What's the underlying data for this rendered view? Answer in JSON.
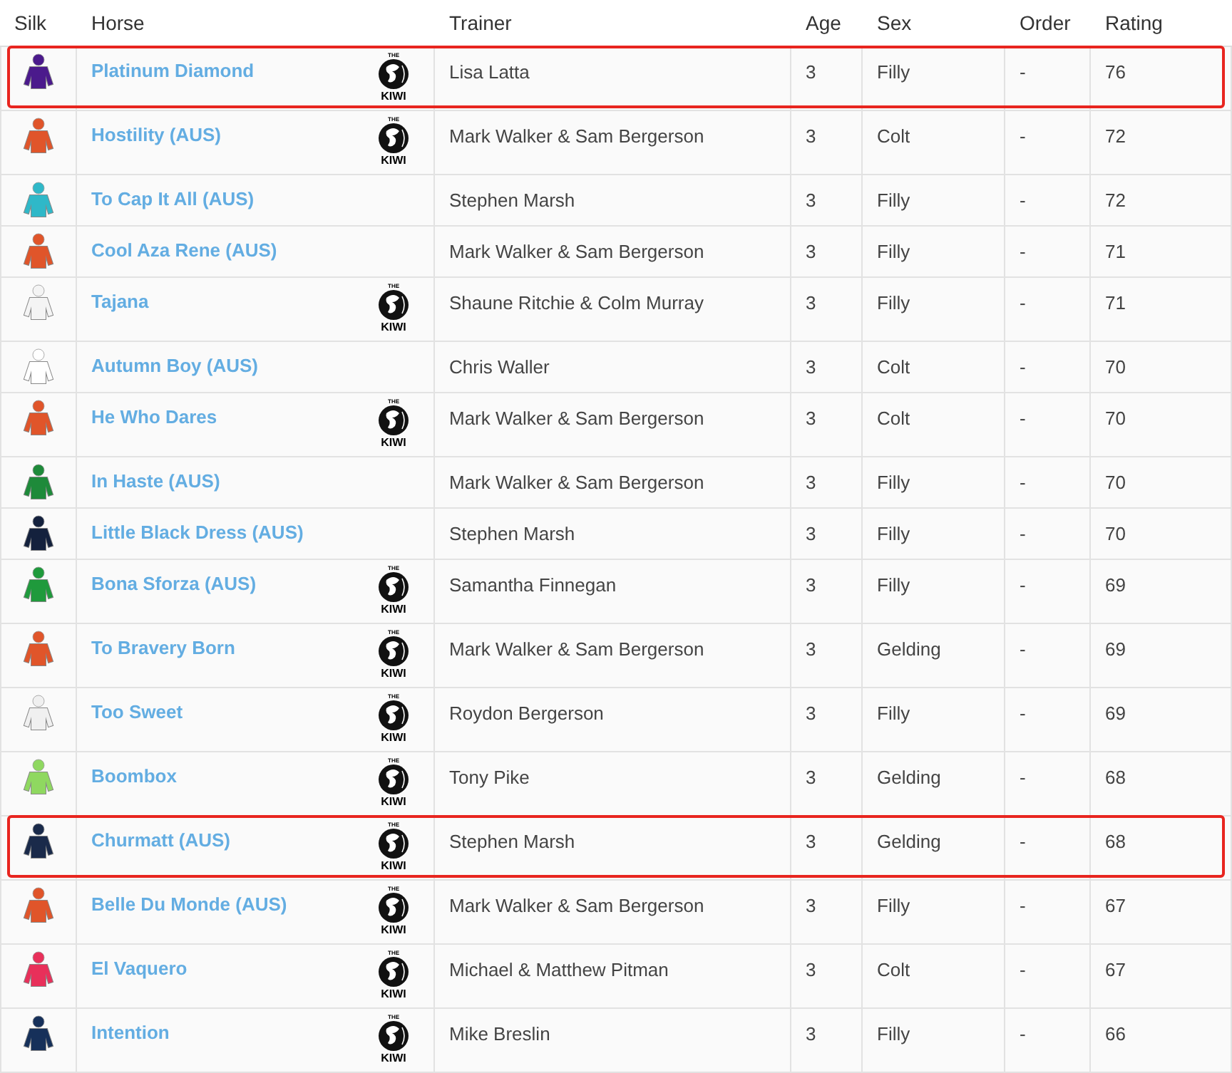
{
  "columns": [
    "Silk",
    "Horse",
    "Trainer",
    "Age",
    "Sex",
    "Order",
    "Rating"
  ],
  "rows": [
    {
      "horse": "Platinum Diamond",
      "trainer": "Lisa Latta",
      "age": "3",
      "sex": "Filly",
      "order": "-",
      "rating": "76",
      "color": "#4b1a8c",
      "highlighted": true,
      "badge": [
        "THE",
        "KIWI"
      ]
    },
    {
      "horse": "Hostility (AUS)",
      "trainer": "Mark Walker & Sam Bergerson",
      "age": "3",
      "sex": "Colt",
      "order": "-",
      "rating": "72",
      "color": "#e0552a",
      "highlighted": false,
      "badge": [
        "THE",
        "KIWI"
      ]
    },
    {
      "horse": "To Cap It All (AUS)",
      "trainer": "Stephen Marsh",
      "age": "3",
      "sex": "Filly",
      "order": "-",
      "rating": "72",
      "color": "#2fb8c8",
      "highlighted": false
    },
    {
      "horse": "Cool Aza Rene (AUS)",
      "trainer": "Mark Walker & Sam Bergerson",
      "age": "3",
      "sex": "Filly",
      "order": "-",
      "rating": "71",
      "color": "#e0552a",
      "highlighted": false
    },
    {
      "horse": "Tajana",
      "trainer": "Shaune Ritchie & Colm Murray",
      "age": "3",
      "sex": "Filly",
      "order": "-",
      "rating": "71",
      "color": "#f4f4f4",
      "highlighted": false,
      "badge": [
        "THE",
        "KIWI"
      ]
    },
    {
      "horse": "Autumn Boy (AUS)",
      "trainer": "Chris Waller",
      "age": "3",
      "sex": "Colt",
      "order": "-",
      "rating": "70",
      "color": "#ffffff",
      "highlighted": false
    },
    {
      "horse": "He Who Dares",
      "trainer": "Mark Walker & Sam Bergerson",
      "age": "3",
      "sex": "Colt",
      "order": "-",
      "rating": "70",
      "color": "#e0552a",
      "highlighted": false,
      "badge": [
        "THE",
        "KIWI"
      ]
    },
    {
      "horse": "In Haste (AUS)",
      "trainer": "Mark Walker & Sam Bergerson",
      "age": "3",
      "sex": "Filly",
      "order": "-",
      "rating": "70",
      "color": "#1e8a3a",
      "highlighted": false
    },
    {
      "horse": "Little Black Dress (AUS)",
      "trainer": "Stephen Marsh",
      "age": "3",
      "sex": "Filly",
      "order": "-",
      "rating": "70",
      "color": "#14213d",
      "highlighted": false
    },
    {
      "horse": "Bona Sforza (AUS)",
      "trainer": "Samantha Finnegan",
      "age": "3",
      "sex": "Filly",
      "order": "-",
      "rating": "69",
      "color": "#1f9a3c",
      "highlighted": false,
      "badge": [
        "THE",
        "KIWI"
      ]
    },
    {
      "horse": "To Bravery Born",
      "trainer": "Mark Walker & Sam Bergerson",
      "age": "3",
      "sex": "Gelding",
      "order": "-",
      "rating": "69",
      "color": "#e0552a",
      "highlighted": false,
      "badge": [
        "THE",
        "KIWI"
      ]
    },
    {
      "horse": "Too Sweet",
      "trainer": "Roydon Bergerson",
      "age": "3",
      "sex": "Filly",
      "order": "-",
      "rating": "69",
      "color": "#f0f0f0",
      "highlighted": false,
      "badge": [
        "THE",
        "KIWI"
      ]
    },
    {
      "horse": "Boombox",
      "trainer": "Tony Pike",
      "age": "3",
      "sex": "Gelding",
      "order": "-",
      "rating": "68",
      "color": "#8fd860",
      "highlighted": false,
      "badge": [
        "THE",
        "KIWI"
      ]
    },
    {
      "horse": "Churmatt (AUS)",
      "trainer": "Stephen Marsh",
      "age": "3",
      "sex": "Gelding",
      "order": "-",
      "rating": "68",
      "color": "#1a2a4a",
      "highlighted": true,
      "badge": [
        "THE",
        "KIWI"
      ]
    },
    {
      "horse": "Belle Du Monde (AUS)",
      "trainer": "Mark Walker & Sam Bergerson",
      "age": "3",
      "sex": "Filly",
      "order": "-",
      "rating": "67",
      "color": "#e0552a",
      "highlighted": false,
      "badge": [
        "THE",
        "KIWI"
      ]
    },
    {
      "horse": "El Vaquero",
      "trainer": "Michael & Matthew Pitman",
      "age": "3",
      "sex": "Colt",
      "order": "-",
      "rating": "67",
      "color": "#e8305a",
      "highlighted": false,
      "badge": [
        "THE",
        "KIWI"
      ]
    },
    {
      "horse": "Intention",
      "trainer": "Mike Breslin",
      "age": "3",
      "sex": "Filly",
      "order": "-",
      "rating": "66",
      "color": "#16305a",
      "highlighted": false,
      "badge": [
        "THE",
        "KIWI"
      ]
    }
  ]
}
